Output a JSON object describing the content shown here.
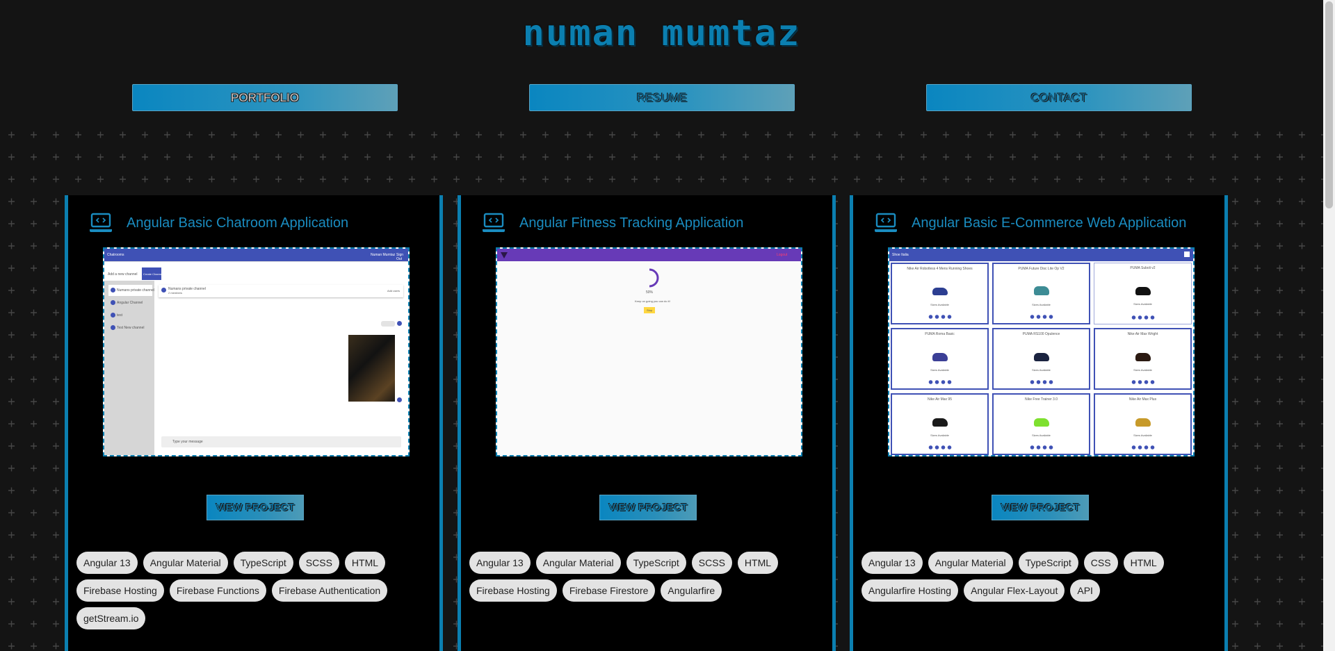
{
  "header": {
    "title": "numan mumtaz"
  },
  "nav": [
    {
      "label": "PORTFOLIO"
    },
    {
      "label": "RESUME"
    },
    {
      "label": "CONTACT"
    }
  ],
  "colors": {
    "accent": "#0b7fb0",
    "background": "#141414",
    "card": "#000000",
    "tag_bg": "#e3e3e3"
  },
  "projects": [
    {
      "icon": "laptop-code-icon",
      "title": "Angular Basic Chatroom Application",
      "button": "VIEW PROJECT",
      "tags": [
        "Angular 13",
        "Angular Material",
        "TypeScript",
        "SCSS",
        "HTML",
        "Firebase Hosting",
        "Firebase Functions",
        "Firebase Authentication",
        "getStream.io"
      ],
      "preview": {
        "app_name": "Chatrooms",
        "user": "Numan Mumtaz",
        "sign_out": "Sign Out",
        "search_placeholder": "Add a new channel",
        "create_button": "Create Channel",
        "channels": [
          "Numans private channel",
          "Angular Channel",
          "test",
          "Test New channel"
        ],
        "active_channel": "Numans private channel",
        "members": "2 members",
        "add_users": "Add users",
        "msg_placeholder": "Type your message"
      }
    },
    {
      "icon": "laptop-code-icon",
      "title": "Angular Fitness Tracking Application",
      "button": "VIEW PROJECT",
      "tags": [
        "Angular 13",
        "Angular Material",
        "TypeScript",
        "SCSS",
        "HTML",
        "Firebase Hosting",
        "Firebase Firestore",
        "Angularfire"
      ],
      "preview": {
        "logout": "Logout",
        "progress": "50%",
        "caption": "Keep on going you can do it!",
        "stop": "Stop"
      }
    },
    {
      "icon": "laptop-code-icon",
      "title": "Angular Basic E-Commerce Web Application",
      "button": "VIEW PROJECT",
      "tags": [
        "Angular 13",
        "Angular Material",
        "TypeScript",
        "CSS",
        "HTML",
        "Angularfire Hosting",
        "Angular Flex-Layout",
        "API"
      ],
      "preview": {
        "store_name": "Shoe Italia",
        "products": [
          "Nike Air Robotless 4 Mens Running Shoes",
          "PUMA Future Disc Lite Op V2",
          "PUMA Suboli v2",
          "PUMA Roma Basic",
          "PUMA RS100 Opulence",
          "Nike Air Max Wright",
          "Nike Air Max 95",
          "Nike Free Trainer 3.0",
          "Nike Air Max Plus"
        ],
        "stock": "Sizes Available"
      }
    }
  ]
}
